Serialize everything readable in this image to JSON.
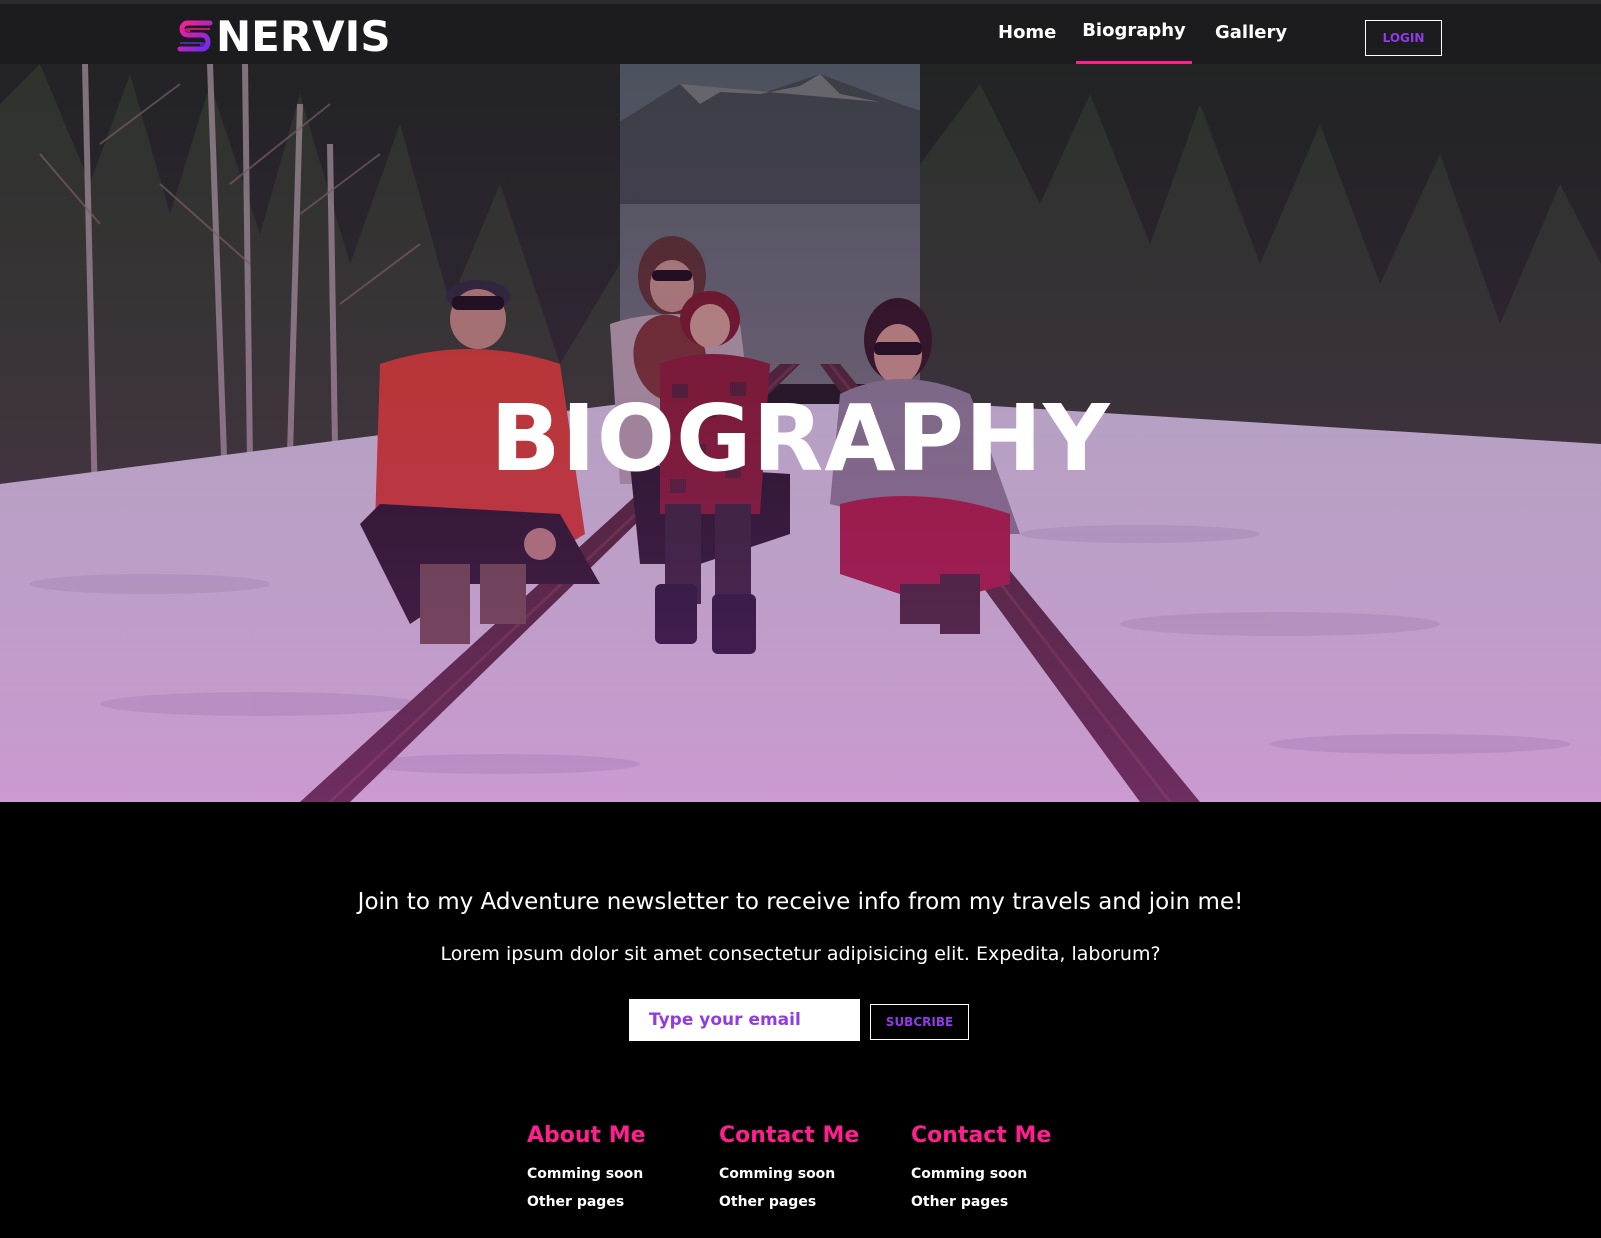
{
  "header": {
    "logo_text": "NERVIS",
    "nav": {
      "home": "Home",
      "biography": "Biography",
      "gallery": "Gallery"
    },
    "login_label": "LOGIN"
  },
  "hero": {
    "title": "BIOGRAPHY"
  },
  "newsletter": {
    "heading": "Join to my Adventure newsletter to receive info from my travels and join me!",
    "subtext": "Lorem ipsum dolor sit amet consectetur adipisicing elit. Expedita, laborum?",
    "email_placeholder": "Type your email",
    "subscribe_label": "SUBCRIBE"
  },
  "footer": {
    "columns": [
      {
        "title": "About Me",
        "links": [
          "Comming soon",
          "Other pages"
        ]
      },
      {
        "title": "Contact Me",
        "links": [
          "Comming soon",
          "Other pages"
        ]
      },
      {
        "title": "Contact Me",
        "links": [
          "Comming soon",
          "Other pages"
        ]
      }
    ]
  },
  "colors": {
    "accent_pink": "#ff1f8e",
    "accent_purple": "#8f3be6",
    "header_bg": "#1c1c1e",
    "page_bg": "#000000"
  }
}
